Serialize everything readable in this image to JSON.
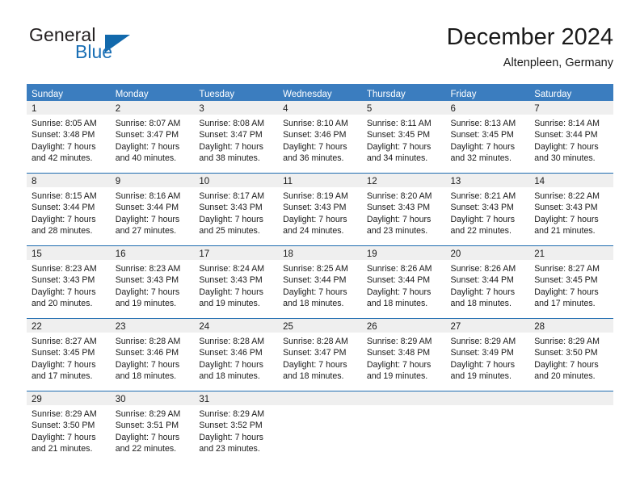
{
  "brand": {
    "name_top": "General",
    "name_bottom": "Blue",
    "triangle_color": "#1269ac",
    "text_color": "#231f20",
    "blue_color": "#1a6fb5"
  },
  "header": {
    "title": "December 2024",
    "subtitle": "Altenpleen, Germany"
  },
  "theme": {
    "header_bg": "#3b7dbf",
    "header_text": "#ffffff",
    "row_divider": "#1f6cb0",
    "daynum_band": "#efefef",
    "body_bg": "#ffffff",
    "text": "#1a1a1a"
  },
  "weekdays": [
    "Sunday",
    "Monday",
    "Tuesday",
    "Wednesday",
    "Thursday",
    "Friday",
    "Saturday"
  ],
  "weeks": [
    [
      {
        "day": "1",
        "sunrise": "Sunrise: 8:05 AM",
        "sunset": "Sunset: 3:48 PM",
        "daylight1": "Daylight: 7 hours",
        "daylight2": "and 42 minutes."
      },
      {
        "day": "2",
        "sunrise": "Sunrise: 8:07 AM",
        "sunset": "Sunset: 3:47 PM",
        "daylight1": "Daylight: 7 hours",
        "daylight2": "and 40 minutes."
      },
      {
        "day": "3",
        "sunrise": "Sunrise: 8:08 AM",
        "sunset": "Sunset: 3:47 PM",
        "daylight1": "Daylight: 7 hours",
        "daylight2": "and 38 minutes."
      },
      {
        "day": "4",
        "sunrise": "Sunrise: 8:10 AM",
        "sunset": "Sunset: 3:46 PM",
        "daylight1": "Daylight: 7 hours",
        "daylight2": "and 36 minutes."
      },
      {
        "day": "5",
        "sunrise": "Sunrise: 8:11 AM",
        "sunset": "Sunset: 3:45 PM",
        "daylight1": "Daylight: 7 hours",
        "daylight2": "and 34 minutes."
      },
      {
        "day": "6",
        "sunrise": "Sunrise: 8:13 AM",
        "sunset": "Sunset: 3:45 PM",
        "daylight1": "Daylight: 7 hours",
        "daylight2": "and 32 minutes."
      },
      {
        "day": "7",
        "sunrise": "Sunrise: 8:14 AM",
        "sunset": "Sunset: 3:44 PM",
        "daylight1": "Daylight: 7 hours",
        "daylight2": "and 30 minutes."
      }
    ],
    [
      {
        "day": "8",
        "sunrise": "Sunrise: 8:15 AM",
        "sunset": "Sunset: 3:44 PM",
        "daylight1": "Daylight: 7 hours",
        "daylight2": "and 28 minutes."
      },
      {
        "day": "9",
        "sunrise": "Sunrise: 8:16 AM",
        "sunset": "Sunset: 3:44 PM",
        "daylight1": "Daylight: 7 hours",
        "daylight2": "and 27 minutes."
      },
      {
        "day": "10",
        "sunrise": "Sunrise: 8:17 AM",
        "sunset": "Sunset: 3:43 PM",
        "daylight1": "Daylight: 7 hours",
        "daylight2": "and 25 minutes."
      },
      {
        "day": "11",
        "sunrise": "Sunrise: 8:19 AM",
        "sunset": "Sunset: 3:43 PM",
        "daylight1": "Daylight: 7 hours",
        "daylight2": "and 24 minutes."
      },
      {
        "day": "12",
        "sunrise": "Sunrise: 8:20 AM",
        "sunset": "Sunset: 3:43 PM",
        "daylight1": "Daylight: 7 hours",
        "daylight2": "and 23 minutes."
      },
      {
        "day": "13",
        "sunrise": "Sunrise: 8:21 AM",
        "sunset": "Sunset: 3:43 PM",
        "daylight1": "Daylight: 7 hours",
        "daylight2": "and 22 minutes."
      },
      {
        "day": "14",
        "sunrise": "Sunrise: 8:22 AM",
        "sunset": "Sunset: 3:43 PM",
        "daylight1": "Daylight: 7 hours",
        "daylight2": "and 21 minutes."
      }
    ],
    [
      {
        "day": "15",
        "sunrise": "Sunrise: 8:23 AM",
        "sunset": "Sunset: 3:43 PM",
        "daylight1": "Daylight: 7 hours",
        "daylight2": "and 20 minutes."
      },
      {
        "day": "16",
        "sunrise": "Sunrise: 8:23 AM",
        "sunset": "Sunset: 3:43 PM",
        "daylight1": "Daylight: 7 hours",
        "daylight2": "and 19 minutes."
      },
      {
        "day": "17",
        "sunrise": "Sunrise: 8:24 AM",
        "sunset": "Sunset: 3:43 PM",
        "daylight1": "Daylight: 7 hours",
        "daylight2": "and 19 minutes."
      },
      {
        "day": "18",
        "sunrise": "Sunrise: 8:25 AM",
        "sunset": "Sunset: 3:44 PM",
        "daylight1": "Daylight: 7 hours",
        "daylight2": "and 18 minutes."
      },
      {
        "day": "19",
        "sunrise": "Sunrise: 8:26 AM",
        "sunset": "Sunset: 3:44 PM",
        "daylight1": "Daylight: 7 hours",
        "daylight2": "and 18 minutes."
      },
      {
        "day": "20",
        "sunrise": "Sunrise: 8:26 AM",
        "sunset": "Sunset: 3:44 PM",
        "daylight1": "Daylight: 7 hours",
        "daylight2": "and 18 minutes."
      },
      {
        "day": "21",
        "sunrise": "Sunrise: 8:27 AM",
        "sunset": "Sunset: 3:45 PM",
        "daylight1": "Daylight: 7 hours",
        "daylight2": "and 17 minutes."
      }
    ],
    [
      {
        "day": "22",
        "sunrise": "Sunrise: 8:27 AM",
        "sunset": "Sunset: 3:45 PM",
        "daylight1": "Daylight: 7 hours",
        "daylight2": "and 17 minutes."
      },
      {
        "day": "23",
        "sunrise": "Sunrise: 8:28 AM",
        "sunset": "Sunset: 3:46 PM",
        "daylight1": "Daylight: 7 hours",
        "daylight2": "and 18 minutes."
      },
      {
        "day": "24",
        "sunrise": "Sunrise: 8:28 AM",
        "sunset": "Sunset: 3:46 PM",
        "daylight1": "Daylight: 7 hours",
        "daylight2": "and 18 minutes."
      },
      {
        "day": "25",
        "sunrise": "Sunrise: 8:28 AM",
        "sunset": "Sunset: 3:47 PM",
        "daylight1": "Daylight: 7 hours",
        "daylight2": "and 18 minutes."
      },
      {
        "day": "26",
        "sunrise": "Sunrise: 8:29 AM",
        "sunset": "Sunset: 3:48 PM",
        "daylight1": "Daylight: 7 hours",
        "daylight2": "and 19 minutes."
      },
      {
        "day": "27",
        "sunrise": "Sunrise: 8:29 AM",
        "sunset": "Sunset: 3:49 PM",
        "daylight1": "Daylight: 7 hours",
        "daylight2": "and 19 minutes."
      },
      {
        "day": "28",
        "sunrise": "Sunrise: 8:29 AM",
        "sunset": "Sunset: 3:50 PM",
        "daylight1": "Daylight: 7 hours",
        "daylight2": "and 20 minutes."
      }
    ],
    [
      {
        "day": "29",
        "sunrise": "Sunrise: 8:29 AM",
        "sunset": "Sunset: 3:50 PM",
        "daylight1": "Daylight: 7 hours",
        "daylight2": "and 21 minutes."
      },
      {
        "day": "30",
        "sunrise": "Sunrise: 8:29 AM",
        "sunset": "Sunset: 3:51 PM",
        "daylight1": "Daylight: 7 hours",
        "daylight2": "and 22 minutes."
      },
      {
        "day": "31",
        "sunrise": "Sunrise: 8:29 AM",
        "sunset": "Sunset: 3:52 PM",
        "daylight1": "Daylight: 7 hours",
        "daylight2": "and 23 minutes."
      },
      {
        "day": "",
        "sunrise": "",
        "sunset": "",
        "daylight1": "",
        "daylight2": ""
      },
      {
        "day": "",
        "sunrise": "",
        "sunset": "",
        "daylight1": "",
        "daylight2": ""
      },
      {
        "day": "",
        "sunrise": "",
        "sunset": "",
        "daylight1": "",
        "daylight2": ""
      },
      {
        "day": "",
        "sunrise": "",
        "sunset": "",
        "daylight1": "",
        "daylight2": ""
      }
    ]
  ]
}
